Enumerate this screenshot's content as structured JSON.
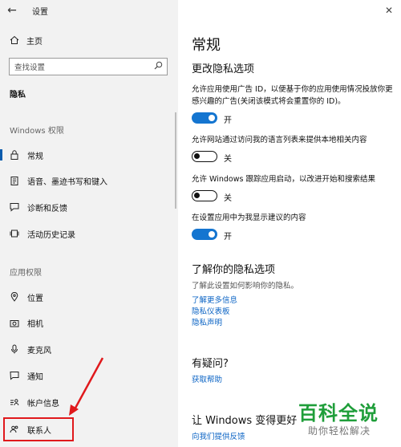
{
  "window": {
    "title": "设置",
    "back_icon": "arrow-left-icon",
    "close_icon": "close-icon"
  },
  "sidebar": {
    "home_label": "主页",
    "search_placeholder": "查找设置",
    "section_title": "隐私",
    "windows_group_title": "Windows 权限",
    "windows_items": [
      {
        "label": "常规",
        "icon": "lock-icon",
        "active": true
      },
      {
        "label": "语音、墨迹书写和键入",
        "icon": "notepad-icon"
      },
      {
        "label": "诊断和反馈",
        "icon": "feedback-icon"
      },
      {
        "label": "活动历史记录",
        "icon": "history-icon"
      }
    ],
    "app_group_title": "应用权限",
    "app_items": [
      {
        "label": "位置",
        "icon": "location-icon"
      },
      {
        "label": "相机",
        "icon": "camera-icon"
      },
      {
        "label": "麦克风",
        "icon": "microphone-icon"
      },
      {
        "label": "通知",
        "icon": "notification-icon"
      },
      {
        "label": "帐户信息",
        "icon": "account-icon"
      },
      {
        "label": "联系人",
        "icon": "contacts-icon"
      }
    ]
  },
  "main": {
    "heading": "常规",
    "subheading": "更改隐私选项",
    "options": [
      {
        "text": "允许应用使用广告 ID，以便基于你的应用使用情况投放你更感兴趣的广告(关闭该模式将会重置你的 ID)。",
        "state": "开",
        "on": true
      },
      {
        "text": "允许网站通过访问我的语言列表来提供本地相关内容",
        "state": "关",
        "on": false
      },
      {
        "text": "允许 Windows 跟踪应用启动，以改进开始和搜索结果",
        "state": "关",
        "on": false
      },
      {
        "text": "在设置应用中为我显示建议的内容",
        "state": "开",
        "on": true
      }
    ],
    "know_heading": "了解你的隐私选项",
    "know_desc": "了解此设置如何影响你的隐私。",
    "know_links": [
      "了解更多信息",
      "隐私仪表板",
      "隐私声明"
    ],
    "question_heading": "有疑问?",
    "question_link": "获取帮助",
    "improve_heading": "让 Windows 变得更好",
    "improve_link": "向我们提供反馈"
  },
  "watermark": {
    "big": "百科全说",
    "small": "助你轻松解决"
  },
  "colors": {
    "accent": "#1475d0",
    "link": "#0a63c4",
    "annotation": "#e0191c",
    "watermark": "#1f9e3a"
  }
}
